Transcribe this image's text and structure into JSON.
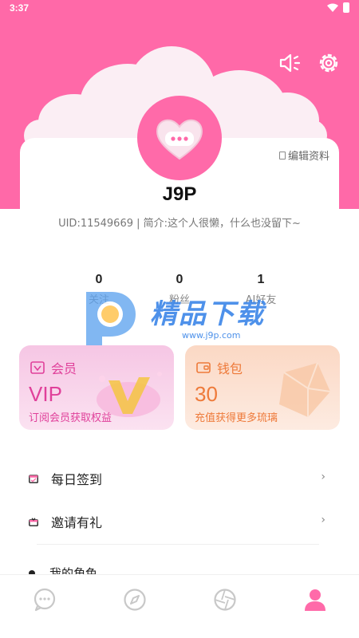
{
  "status_bar": {
    "time": "3:37"
  },
  "header": {
    "accent": "#ff69a8",
    "actions": [
      {
        "name": "speaker-icon"
      },
      {
        "name": "settings-icon"
      }
    ]
  },
  "profile": {
    "edit_label": "编辑资料",
    "username": "J9P",
    "bio_line": "UID:11549669 | 简介:这个人很懒，什么也没留下~"
  },
  "stats": [
    {
      "count": "0",
      "label": "关注"
    },
    {
      "count": "0",
      "label": "粉丝"
    },
    {
      "count": "1",
      "label": "AI好友"
    }
  ],
  "watermark": {
    "text": "精品下载",
    "url": "www.j9p.com"
  },
  "cards": {
    "vip": {
      "title": "会员",
      "value": "VIP",
      "subtitle": "订阅会员获取权益",
      "color": "#e0409a"
    },
    "wallet": {
      "title": "钱包",
      "value": "30",
      "subtitle": "充值获得更多琉璃",
      "color": "#ee7a3a"
    }
  },
  "menu": [
    {
      "label": "每日签到",
      "icon": "calendar-check-icon"
    },
    {
      "label": "邀请有礼",
      "icon": "gift-icon"
    }
  ],
  "partial_menu_label": "我的角色",
  "tabbar": [
    {
      "name": "chat-icon",
      "active": false
    },
    {
      "name": "compass-icon",
      "active": false
    },
    {
      "name": "aperture-icon",
      "active": false
    },
    {
      "name": "profile-icon",
      "active": true
    }
  ]
}
